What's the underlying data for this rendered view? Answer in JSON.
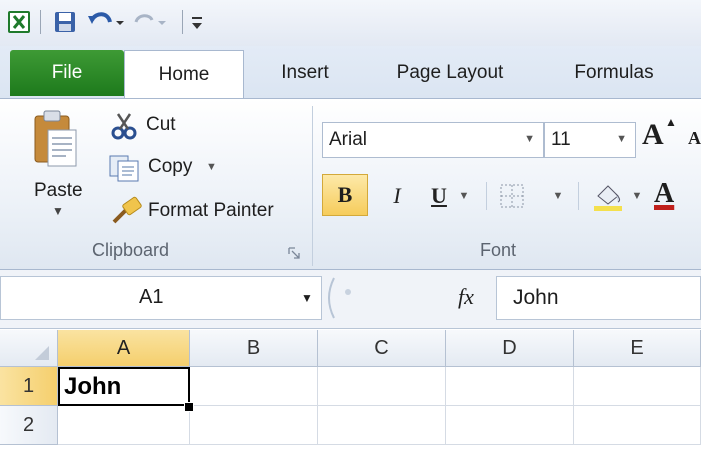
{
  "app": {
    "accent": "#1d7a1c"
  },
  "quick_access": {
    "icons": [
      "excel-icon",
      "save-icon",
      "undo-icon",
      "redo-icon",
      "customize-icon"
    ]
  },
  "tabs": [
    {
      "label": "File"
    },
    {
      "label": "Home"
    },
    {
      "label": "Insert"
    },
    {
      "label": "Page Layout"
    },
    {
      "label": "Formulas"
    }
  ],
  "clipboard": {
    "paste_label": "Paste",
    "cut_label": "Cut",
    "copy_label": "Copy",
    "format_painter_label": "Format Painter",
    "group_label": "Clipboard"
  },
  "font": {
    "font_name": "Arial",
    "font_size": "11",
    "bold": "B",
    "italic": "I",
    "underline": "U",
    "group_label": "Font",
    "grow_label": "A",
    "color_label": "A"
  },
  "formula_bar": {
    "name_box": "A1",
    "fx": "fx",
    "value": "John"
  },
  "grid": {
    "columns": [
      "A",
      "B",
      "C",
      "D",
      "E"
    ],
    "rows": [
      "1",
      "2"
    ],
    "cells": {
      "A1": "John"
    }
  }
}
